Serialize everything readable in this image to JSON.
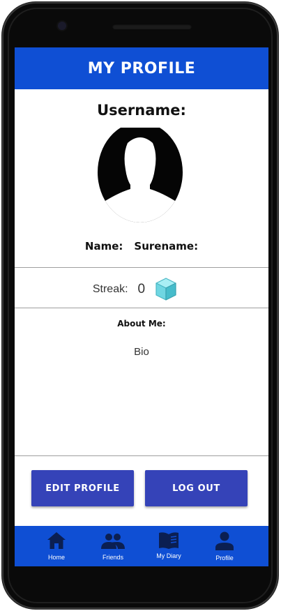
{
  "header": {
    "title": "MY  PROFILE"
  },
  "profile": {
    "username_label": "Username:",
    "name_label": "Name:",
    "surname_label": "Surename:"
  },
  "streak": {
    "label": "Streak:",
    "value": "0",
    "icon": "cube-icon"
  },
  "about": {
    "title": "About Me:",
    "bio": "Bio"
  },
  "actions": {
    "edit_label": "EDIT PROFILE",
    "logout_label": "LOG OUT"
  },
  "bottom_nav": {
    "items": [
      {
        "label": "Home",
        "icon": "home-icon"
      },
      {
        "label": "Friends",
        "icon": "people-icon"
      },
      {
        "label": "My Diary",
        "icon": "book-icon"
      },
      {
        "label": "Profile",
        "icon": "person-icon"
      }
    ]
  },
  "colors": {
    "primary": "#0f4fd4",
    "button": "#3543b8",
    "divider": "#9e9e9e",
    "streak_icon": "#5fd3e0"
  }
}
